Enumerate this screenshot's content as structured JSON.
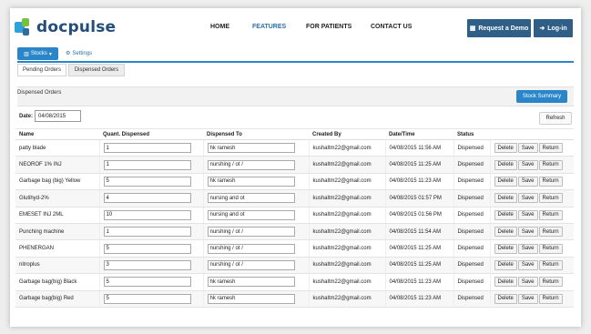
{
  "brand": {
    "name": "docpulse"
  },
  "nav": {
    "items": [
      {
        "label": "HOME",
        "active": false
      },
      {
        "label": "FEATURES",
        "active": true
      },
      {
        "label": "FOR PATIENTS",
        "active": false
      },
      {
        "label": "CONTACT US",
        "active": false
      }
    ],
    "request_demo": "Request a Demo",
    "login": "Log-in"
  },
  "toolbar": {
    "stocks_label": "Stocks",
    "settings_label": "Settings"
  },
  "tabs": [
    {
      "label": "Pending Orders"
    },
    {
      "label": "Dispensed Orders",
      "active": true
    }
  ],
  "panel": {
    "title": "Dispensed Orders",
    "stock_summary": "Stock Summary",
    "date_label": "Date:",
    "date_value": "04/08/2015",
    "refresh": "Refresh"
  },
  "table": {
    "columns": [
      "Name",
      "Quant. Dispensed",
      "Dispensed To",
      "Created By",
      "Date/Time",
      "Status",
      ""
    ],
    "actions": [
      "Delete",
      "Save",
      "Return"
    ],
    "rows": [
      {
        "name": "patty blade",
        "qty": "1",
        "to": "hk ramesh",
        "by": "kushaltm22@gmail.com",
        "dt": "04/08/2015 11:56 AM",
        "status": "Dispensed"
      },
      {
        "name": "NEOROF 1% INJ",
        "qty": "1",
        "to": "nurshing / ot /",
        "by": "kushaltm22@gmail.com",
        "dt": "04/08/2015 11:25 AM",
        "status": "Dispensed"
      },
      {
        "name": "Garbage bag (big) Yellow",
        "qty": "5",
        "to": "hk ramesh",
        "by": "kushaltm22@gmail.com",
        "dt": "04/08/2015 11:23 AM",
        "status": "Dispensed"
      },
      {
        "name": "Glutihyd-2%",
        "qty": "4",
        "to": "nursing and ot",
        "by": "kushaltm22@gmail.com",
        "dt": "04/08/2015 01:57 PM",
        "status": "Dispensed"
      },
      {
        "name": "EMESET INJ 2ML",
        "qty": "10",
        "to": "nursing and ot",
        "by": "kushaltm22@gmail.com",
        "dt": "04/08/2015 01:56 PM",
        "status": "Dispensed"
      },
      {
        "name": "Punching machine",
        "qty": "1",
        "to": "nurshing / ot /",
        "by": "kushaltm22@gmail.com",
        "dt": "04/08/2015 11:54 AM",
        "status": "Dispensed"
      },
      {
        "name": "PHENERGAN",
        "qty": "5",
        "to": "nurshing / ot /",
        "by": "kushaltm22@gmail.com",
        "dt": "04/08/2015 11:25 AM",
        "status": "Dispensed"
      },
      {
        "name": "nitroplus",
        "qty": "3",
        "to": "nurshing / ot /",
        "by": "kushaltm22@gmail.com",
        "dt": "04/08/2015 11:25 AM",
        "status": "Dispensed"
      },
      {
        "name": "Garbage bag(big) Black",
        "qty": "5",
        "to": "hk ramesh",
        "by": "kushaltm22@gmail.com",
        "dt": "04/08/2015 11:23 AM",
        "status": "Dispensed"
      },
      {
        "name": "Garbage bag(big) Red",
        "qty": "5",
        "to": "hk ramesh",
        "by": "kushaltm22@gmail.com",
        "dt": "04/08/2015 11:23 AM",
        "status": "Dispensed"
      }
    ]
  }
}
